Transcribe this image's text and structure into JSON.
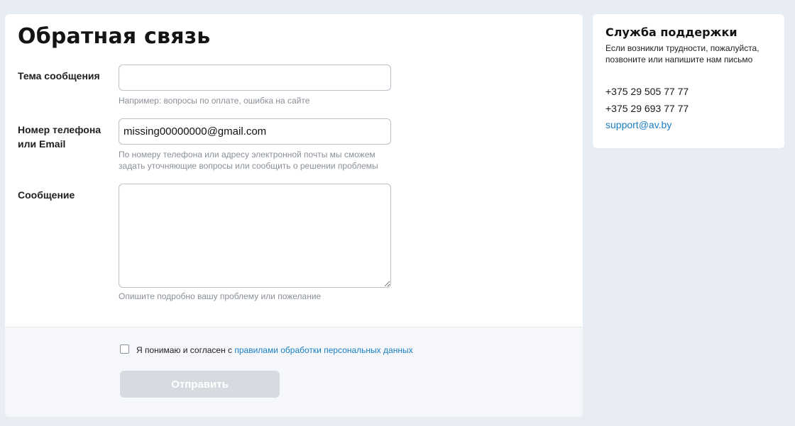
{
  "form": {
    "title": "Обратная связь",
    "subject_label": "Тема сообщения",
    "subject_value": "",
    "subject_hint": "Например: вопросы по оплате, ошибка на сайте",
    "contact_label": "Номер телефона или Email",
    "contact_value": "missing00000000@gmail.com",
    "contact_hint": "По номеру телефона или адресу электронной почты мы сможем задать уточняющие вопросы или сообщить о решении проблемы",
    "message_label": "Сообщение",
    "message_value": "",
    "message_hint": "Опишите подробно вашу проблему или пожелание",
    "consent_checked": false,
    "consent_text": "Я понимаю и согласен с ",
    "consent_link": "правилами обработки персональных данных",
    "submit_label": "Отправить"
  },
  "support": {
    "title": "Служба поддержки",
    "text": "Если возникли трудности, пожалуйста, позвоните или напишите нам письмо",
    "phones": [
      "+375 29 505 77 77",
      "+375 29 693 77 77"
    ],
    "email": "support@av.by"
  },
  "colors": {
    "background": "#e8edf4",
    "link": "#1a7ec4",
    "button_disabled": "#d6dbe1"
  }
}
